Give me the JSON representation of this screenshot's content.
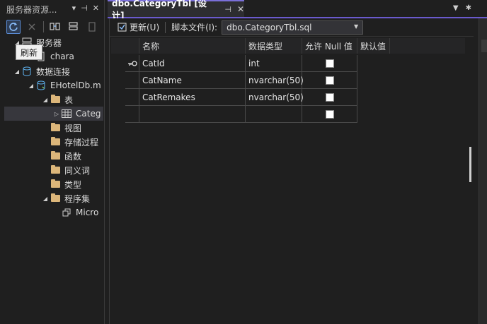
{
  "server_explorer": {
    "title": "服务器资源...",
    "title_icons": [
      "▾",
      "⊣",
      "✕"
    ],
    "tooltip": "刷新",
    "tree": [
      {
        "label": "服务器",
        "level": 0,
        "expanded": true,
        "icon": "server-icon"
      },
      {
        "label": "chara",
        "level": 1,
        "icon": "computer-icon"
      },
      {
        "label": "数据连接",
        "level": 0,
        "expanded": true,
        "icon": "data-connection-icon"
      },
      {
        "label": "EHotelDb.m",
        "level": 1,
        "expanded": true,
        "icon": "database-icon"
      },
      {
        "label": "表",
        "level": 2,
        "expanded": true,
        "icon": "folder-icon"
      },
      {
        "label": "Categ",
        "level": 3,
        "expanded": false,
        "icon": "table-icon",
        "selected": true
      },
      {
        "label": "视图",
        "level": 2,
        "icon": "folder-icon"
      },
      {
        "label": "存储过程",
        "level": 2,
        "icon": "folder-icon"
      },
      {
        "label": "函数",
        "level": 2,
        "icon": "folder-icon"
      },
      {
        "label": "同义词",
        "level": 2,
        "icon": "folder-icon"
      },
      {
        "label": "类型",
        "level": 2,
        "icon": "folder-icon"
      },
      {
        "label": "程序集",
        "level": 2,
        "expanded": true,
        "icon": "folder-icon"
      },
      {
        "label": "Micro",
        "level": 3,
        "icon": "assembly-icon"
      }
    ]
  },
  "document_tab": {
    "title": "dbo.CategoryTbl [设计]",
    "pin": "⊣",
    "close": "✕"
  },
  "designer_toolbar": {
    "update_label": "更新(U)",
    "script_file_label": "脚本文件(I):",
    "script_file_value": "dbo.CategoryTbl.sql"
  },
  "grid": {
    "columns": [
      "名称",
      "数据类型",
      "允许 Null 值",
      "默认值"
    ],
    "rows": [
      {
        "name": "CatId",
        "type": "int",
        "allow_null": false,
        "default": "",
        "primary_key": true
      },
      {
        "name": "CatName",
        "type": "nvarchar(50)",
        "allow_null": false,
        "default": ""
      },
      {
        "name": "CatRemakes",
        "type": "nvarchar(50)",
        "allow_null": false,
        "default": ""
      },
      {
        "name": "",
        "type": "",
        "allow_null": false,
        "default": ""
      }
    ]
  },
  "colors": {
    "accent": "#6a5acd",
    "background": "#1f1f1f",
    "folder": "#dcb67a"
  }
}
